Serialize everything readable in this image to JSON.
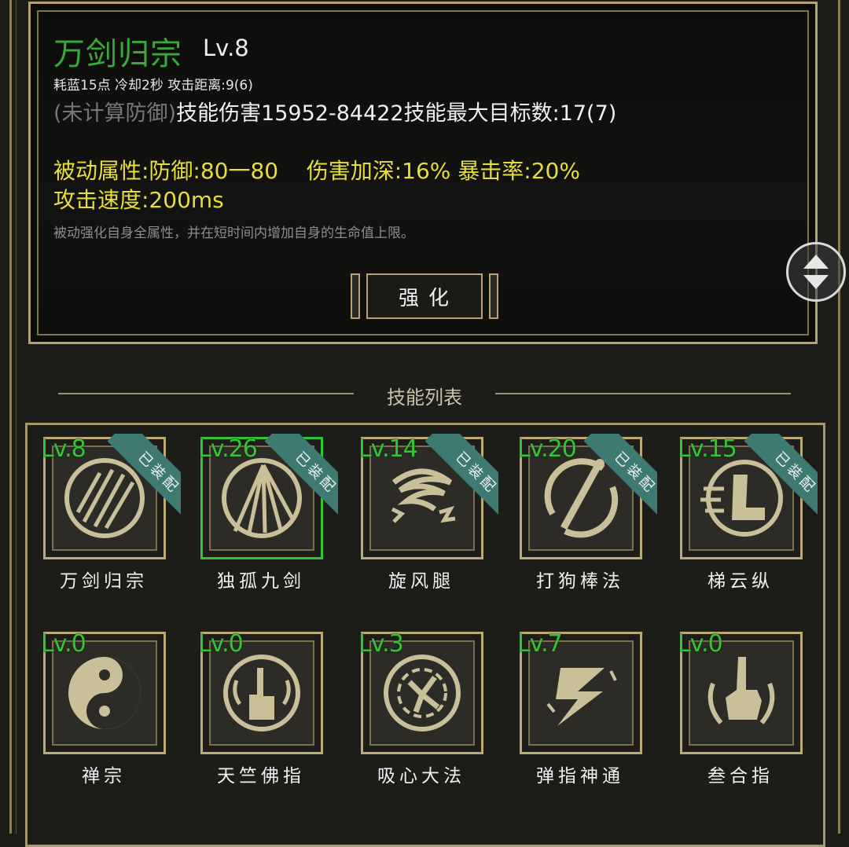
{
  "detail": {
    "name": "万剑归宗",
    "level": "Lv.8",
    "cost_line": "耗蓝15点 冷却2秒 攻击距离:9(6)",
    "damage_note": "(未计算防御)",
    "damage_text": "技能伤害15952-84422技能最大目标数:17(7)",
    "passive_line": "被动属性:防御:80一80    伤害加深:16% 暴击率:20%",
    "speed_line": "攻击速度:200ms",
    "description": "被动强化自身全属性，并在短时间内增加自身的生命值上限。",
    "upgrade_label": "强化"
  },
  "section_title": "技能列表",
  "equipped_label": "已装配",
  "skills": [
    {
      "level": "Lv.8",
      "name": "万剑归宗",
      "equipped": true,
      "selected": false,
      "icon": "sword-rain-icon"
    },
    {
      "level": "Lv.26",
      "name": "独孤九剑",
      "equipped": true,
      "selected": true,
      "icon": "sword-burst-icon"
    },
    {
      "level": "Lv.14",
      "name": "旋风腿",
      "equipped": true,
      "selected": false,
      "icon": "whirlwind-icon"
    },
    {
      "level": "Lv.20",
      "name": "打狗棒法",
      "equipped": true,
      "selected": false,
      "icon": "staff-swing-icon"
    },
    {
      "level": "Lv.15",
      "name": "梯云纵",
      "equipped": true,
      "selected": false,
      "icon": "dash-boot-icon"
    },
    {
      "level": "Lv.0",
      "name": "禅宗",
      "equipped": false,
      "selected": false,
      "icon": "yin-yang-icon"
    },
    {
      "level": "Lv.0",
      "name": "天竺佛指",
      "equipped": false,
      "selected": false,
      "icon": "buddha-finger-icon"
    },
    {
      "level": "Lv.3",
      "name": "吸心大法",
      "equipped": false,
      "selected": false,
      "icon": "absorb-vortex-icon"
    },
    {
      "level": "Lv.7",
      "name": "弹指神通",
      "equipped": false,
      "selected": false,
      "icon": "lightning-flick-icon"
    },
    {
      "level": "Lv.0",
      "name": "叁合指",
      "equipped": false,
      "selected": false,
      "icon": "pointing-fist-icon"
    }
  ],
  "colors": {
    "level_green": "#35c435",
    "title_green": "#3aa83a",
    "passive_yellow": "#e6df39",
    "frame_gold": "#b3a376",
    "ribbon_teal": "#3f7a72",
    "selected_border": "#31c631"
  }
}
